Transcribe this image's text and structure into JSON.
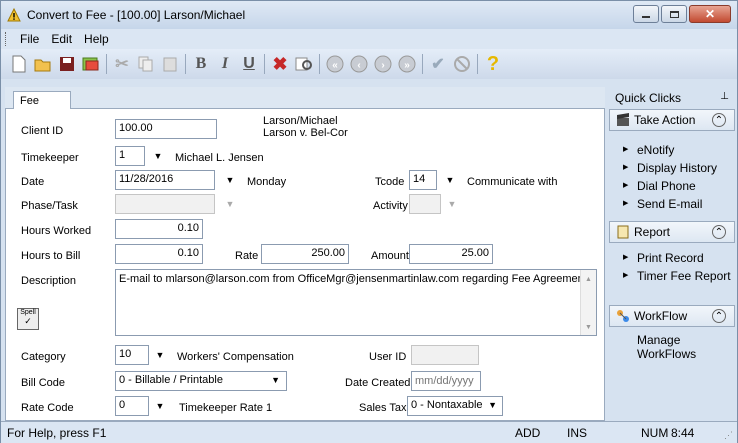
{
  "window": {
    "title": "Convert to Fee - [100.00] Larson/Michael"
  },
  "menus": [
    "File",
    "Edit",
    "Help"
  ],
  "tab": "Fee",
  "form": {
    "client_id_label": "Client ID",
    "client_id": "100.00",
    "client_name": "Larson/Michael",
    "matter_name": "Larson v. Bel-Cor",
    "timekeeper_label": "Timekeeper",
    "timekeeper": "1",
    "timekeeper_name": "Michael L. Jensen",
    "date_label": "Date",
    "date": "11/28/2016",
    "day": "Monday",
    "tcode_label": "Tcode",
    "tcode": "14",
    "tcode_desc": "Communicate with",
    "phase_label": "Phase/Task",
    "activity_label": "Activity",
    "hours_worked_label": "Hours Worked",
    "hours_worked": "0.10",
    "hours_bill_label": "Hours to Bill",
    "hours_bill": "0.10",
    "rate_label": "Rate",
    "rate": "250.00",
    "amount_label": "Amount",
    "amount": "25.00",
    "description_label": "Description",
    "description": "E-mail to mlarson@larson.com from OfficeMgr@jensenmartinlaw.com regarding Fee Agreement.",
    "spell_label": "Spell",
    "category_label": "Category",
    "category": "10",
    "category_desc": "Workers' Compensation",
    "userid_label": "User ID",
    "userid": "",
    "billcode_label": "Bill Code",
    "billcode": "0 - Billable / Printable",
    "datecreated_label": "Date Created",
    "datecreated_placeholder": "mm/dd/yyyy",
    "ratecode_label": "Rate Code",
    "ratecode": "0",
    "ratecode_desc": "Timekeeper Rate 1",
    "salestax_label": "Sales Tax",
    "salestax": "0 - Nontaxable"
  },
  "sidebar": {
    "title": "Quick Clicks",
    "take_action": "Take Action",
    "take_action_items": [
      "eNotify",
      "Display History",
      "Dial Phone",
      "Send E-mail"
    ],
    "report": "Report",
    "report_items": [
      "Print Record",
      "Timer Fee Report"
    ],
    "workflow": "WorkFlow",
    "workflow_items": [
      "Manage WorkFlows"
    ]
  },
  "status": {
    "help": "For Help, press F1",
    "add": "ADD",
    "ins": "INS",
    "num": "NUM",
    "time": "8:44"
  },
  "colors": {
    "accent": "#d6e2f0",
    "close": "#c24a31"
  }
}
